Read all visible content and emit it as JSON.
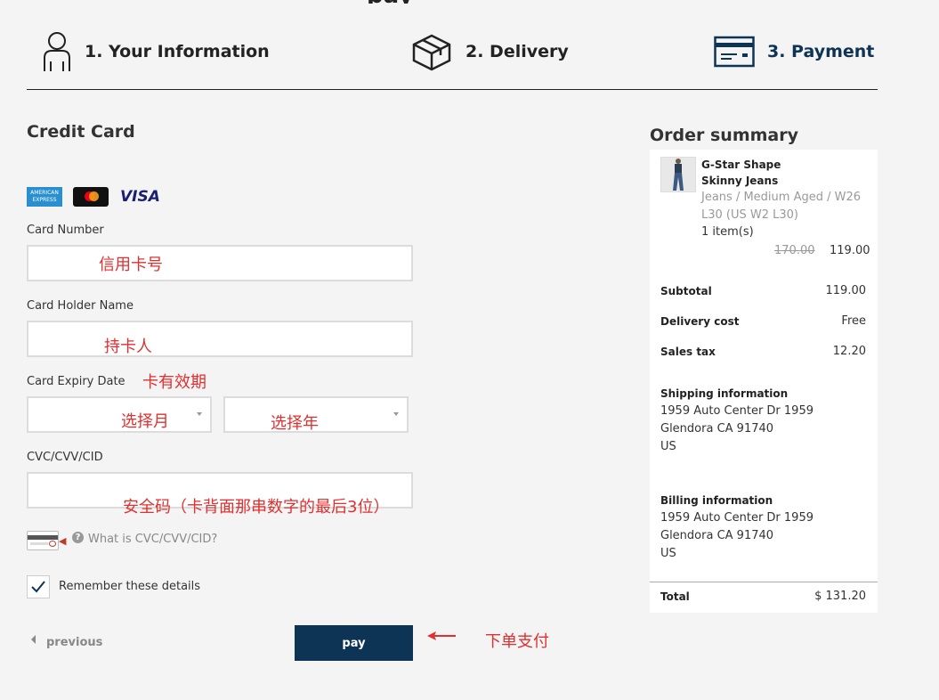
{
  "steps": [
    {
      "label": "1. Your Information"
    },
    {
      "label": "2. Delivery"
    },
    {
      "label": "3. Payment"
    }
  ],
  "payment": {
    "section_title": "Credit Card",
    "card_logos": {
      "amex": "AMERICAN EXPRESS",
      "visa": "VISA"
    },
    "card_number_label": "Card Number",
    "card_holder_label": "Card Holder Name",
    "expiry_label": "Card Expiry Date",
    "cvc_label": "CVC/CVV/CID",
    "cvc_help": "What is CVC/CVV/CID?",
    "remember_label": "Remember these details",
    "previous_label": "previous",
    "pay_label": "pay"
  },
  "annotations": {
    "card_number": "信用卡号",
    "card_holder": "持卡人",
    "expiry": "卡有效期",
    "month": "选择月",
    "year": "选择年",
    "cvc": "安全码（卡背面那串数字的最后3位）",
    "pay": "下单支付"
  },
  "summary": {
    "title": "Order summary",
    "product_name": "G-Star Shape Skinny Jeans",
    "product_attrs": "Jeans / Medium Aged / W26 L30 (US W2 L30)",
    "quantity": "1 item(s)",
    "price_old": "170.00",
    "price_new": "119.00",
    "subtotal_label": "Subtotal",
    "subtotal_value": "119.00",
    "delivery_label": "Delivery cost",
    "delivery_value": "Free",
    "tax_label": "Sales tax",
    "tax_value": "12.20",
    "shipping_title": "Shipping information",
    "shipping_line1": "1959 Auto Center Dr 1959",
    "shipping_line2": "Glendora CA  91740",
    "shipping_line3": "US",
    "billing_title": "Billing information",
    "billing_line1": "1959 Auto Center Dr 1959",
    "billing_line2": "Glendora CA  91740",
    "billing_line3": "US",
    "total_label": "Total",
    "total_value": "$ 131.20"
  },
  "colors": {
    "accent": "#0d3454",
    "annotation": "#e03030",
    "background": "#f4f4f4"
  },
  "icons": [
    "person-icon",
    "box-icon",
    "credit-card-icon",
    "cvc-card-icon",
    "help-icon",
    "checkmark-icon",
    "caret-left-icon",
    "red-arrow-icon"
  ]
}
